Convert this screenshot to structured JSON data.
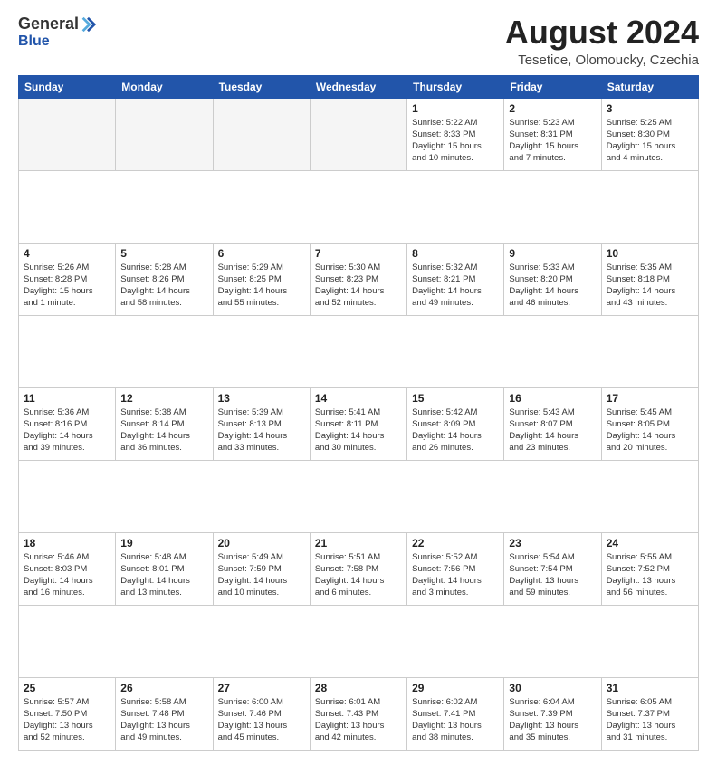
{
  "logo": {
    "general": "General",
    "blue": "Blue"
  },
  "title": "August 2024",
  "subtitle": "Tesetice, Olomoucky, Czechia",
  "days_header": [
    "Sunday",
    "Monday",
    "Tuesday",
    "Wednesday",
    "Thursday",
    "Friday",
    "Saturday"
  ],
  "weeks": [
    [
      {
        "num": "",
        "info": ""
      },
      {
        "num": "",
        "info": ""
      },
      {
        "num": "",
        "info": ""
      },
      {
        "num": "",
        "info": ""
      },
      {
        "num": "1",
        "info": "Sunrise: 5:22 AM\nSunset: 8:33 PM\nDaylight: 15 hours\nand 10 minutes."
      },
      {
        "num": "2",
        "info": "Sunrise: 5:23 AM\nSunset: 8:31 PM\nDaylight: 15 hours\nand 7 minutes."
      },
      {
        "num": "3",
        "info": "Sunrise: 5:25 AM\nSunset: 8:30 PM\nDaylight: 15 hours\nand 4 minutes."
      }
    ],
    [
      {
        "num": "4",
        "info": "Sunrise: 5:26 AM\nSunset: 8:28 PM\nDaylight: 15 hours\nand 1 minute."
      },
      {
        "num": "5",
        "info": "Sunrise: 5:28 AM\nSunset: 8:26 PM\nDaylight: 14 hours\nand 58 minutes."
      },
      {
        "num": "6",
        "info": "Sunrise: 5:29 AM\nSunset: 8:25 PM\nDaylight: 14 hours\nand 55 minutes."
      },
      {
        "num": "7",
        "info": "Sunrise: 5:30 AM\nSunset: 8:23 PM\nDaylight: 14 hours\nand 52 minutes."
      },
      {
        "num": "8",
        "info": "Sunrise: 5:32 AM\nSunset: 8:21 PM\nDaylight: 14 hours\nand 49 minutes."
      },
      {
        "num": "9",
        "info": "Sunrise: 5:33 AM\nSunset: 8:20 PM\nDaylight: 14 hours\nand 46 minutes."
      },
      {
        "num": "10",
        "info": "Sunrise: 5:35 AM\nSunset: 8:18 PM\nDaylight: 14 hours\nand 43 minutes."
      }
    ],
    [
      {
        "num": "11",
        "info": "Sunrise: 5:36 AM\nSunset: 8:16 PM\nDaylight: 14 hours\nand 39 minutes."
      },
      {
        "num": "12",
        "info": "Sunrise: 5:38 AM\nSunset: 8:14 PM\nDaylight: 14 hours\nand 36 minutes."
      },
      {
        "num": "13",
        "info": "Sunrise: 5:39 AM\nSunset: 8:13 PM\nDaylight: 14 hours\nand 33 minutes."
      },
      {
        "num": "14",
        "info": "Sunrise: 5:41 AM\nSunset: 8:11 PM\nDaylight: 14 hours\nand 30 minutes."
      },
      {
        "num": "15",
        "info": "Sunrise: 5:42 AM\nSunset: 8:09 PM\nDaylight: 14 hours\nand 26 minutes."
      },
      {
        "num": "16",
        "info": "Sunrise: 5:43 AM\nSunset: 8:07 PM\nDaylight: 14 hours\nand 23 minutes."
      },
      {
        "num": "17",
        "info": "Sunrise: 5:45 AM\nSunset: 8:05 PM\nDaylight: 14 hours\nand 20 minutes."
      }
    ],
    [
      {
        "num": "18",
        "info": "Sunrise: 5:46 AM\nSunset: 8:03 PM\nDaylight: 14 hours\nand 16 minutes."
      },
      {
        "num": "19",
        "info": "Sunrise: 5:48 AM\nSunset: 8:01 PM\nDaylight: 14 hours\nand 13 minutes."
      },
      {
        "num": "20",
        "info": "Sunrise: 5:49 AM\nSunset: 7:59 PM\nDaylight: 14 hours\nand 10 minutes."
      },
      {
        "num": "21",
        "info": "Sunrise: 5:51 AM\nSunset: 7:58 PM\nDaylight: 14 hours\nand 6 minutes."
      },
      {
        "num": "22",
        "info": "Sunrise: 5:52 AM\nSunset: 7:56 PM\nDaylight: 14 hours\nand 3 minutes."
      },
      {
        "num": "23",
        "info": "Sunrise: 5:54 AM\nSunset: 7:54 PM\nDaylight: 13 hours\nand 59 minutes."
      },
      {
        "num": "24",
        "info": "Sunrise: 5:55 AM\nSunset: 7:52 PM\nDaylight: 13 hours\nand 56 minutes."
      }
    ],
    [
      {
        "num": "25",
        "info": "Sunrise: 5:57 AM\nSunset: 7:50 PM\nDaylight: 13 hours\nand 52 minutes."
      },
      {
        "num": "26",
        "info": "Sunrise: 5:58 AM\nSunset: 7:48 PM\nDaylight: 13 hours\nand 49 minutes."
      },
      {
        "num": "27",
        "info": "Sunrise: 6:00 AM\nSunset: 7:46 PM\nDaylight: 13 hours\nand 45 minutes."
      },
      {
        "num": "28",
        "info": "Sunrise: 6:01 AM\nSunset: 7:43 PM\nDaylight: 13 hours\nand 42 minutes."
      },
      {
        "num": "29",
        "info": "Sunrise: 6:02 AM\nSunset: 7:41 PM\nDaylight: 13 hours\nand 38 minutes."
      },
      {
        "num": "30",
        "info": "Sunrise: 6:04 AM\nSunset: 7:39 PM\nDaylight: 13 hours\nand 35 minutes."
      },
      {
        "num": "31",
        "info": "Sunrise: 6:05 AM\nSunset: 7:37 PM\nDaylight: 13 hours\nand 31 minutes."
      }
    ]
  ]
}
